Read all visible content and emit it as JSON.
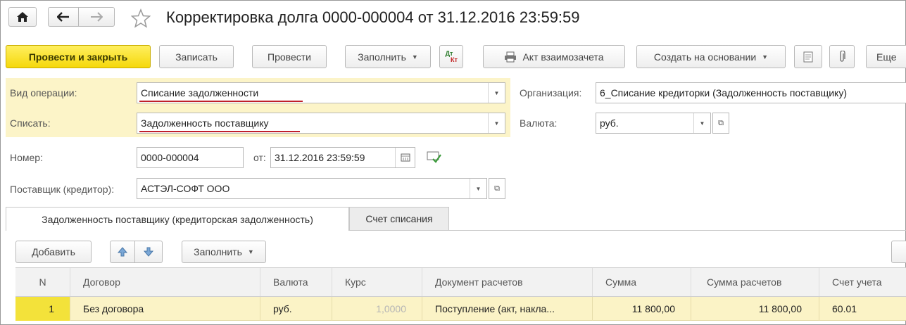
{
  "window": {
    "title": "Корректировка долга 0000-000004 от 31.12.2016 23:59:59"
  },
  "nav": {
    "home_icon": "home-icon",
    "back_icon": "arrow-left-icon",
    "forward_icon": "arrow-right-icon",
    "favorite_icon": "star-icon"
  },
  "toolbar": {
    "post_and_close": "Провести и закрыть",
    "save": "Записать",
    "post": "Провести",
    "fill": "Заполнить",
    "dt_kt_top": "Дт",
    "dt_kt_bottom": "Кт",
    "act": "Акт взаимозачета",
    "create_based": "Создать на основании",
    "more": "Еще"
  },
  "form": {
    "operation_label": "Вид операции:",
    "operation_value": "Списание задолженности",
    "writeoff_label": "Списать:",
    "writeoff_value": "Задолженность поставщику",
    "number_label": "Номер:",
    "number_value": "0000-000004",
    "date_label": "от:",
    "date_value": "31.12.2016 23:59:59",
    "supplier_label": "Поставщик (кредитор):",
    "supplier_value": "АСТЭЛ-СОФТ ООО",
    "org_label": "Организация:",
    "org_value": "6_Списание кредиторки (Задолженность поставщику)",
    "currency_label": "Валюта:",
    "currency_value": "руб."
  },
  "tabs": [
    {
      "label": "Задолженность поставщику (кредиторская задолженность)"
    },
    {
      "label": "Счет списания"
    }
  ],
  "table_toolbar": {
    "add": "Добавить",
    "fill": "Заполнить"
  },
  "table": {
    "columns": [
      "N",
      "Договор",
      "Валюта",
      "Курс",
      "Документ расчетов",
      "Сумма",
      "Сумма расчетов",
      "Счет учета"
    ],
    "rows": [
      [
        "1",
        "Без договора",
        "руб.",
        "1,0000",
        "Поступление (акт, накла...",
        "11 800,00",
        "11 800,00",
        "60.01"
      ]
    ]
  },
  "colors": {
    "accent_yellow": "#f5d80b",
    "highlight_bg": "#fcf4c8",
    "underline_red": "#c0202a"
  }
}
